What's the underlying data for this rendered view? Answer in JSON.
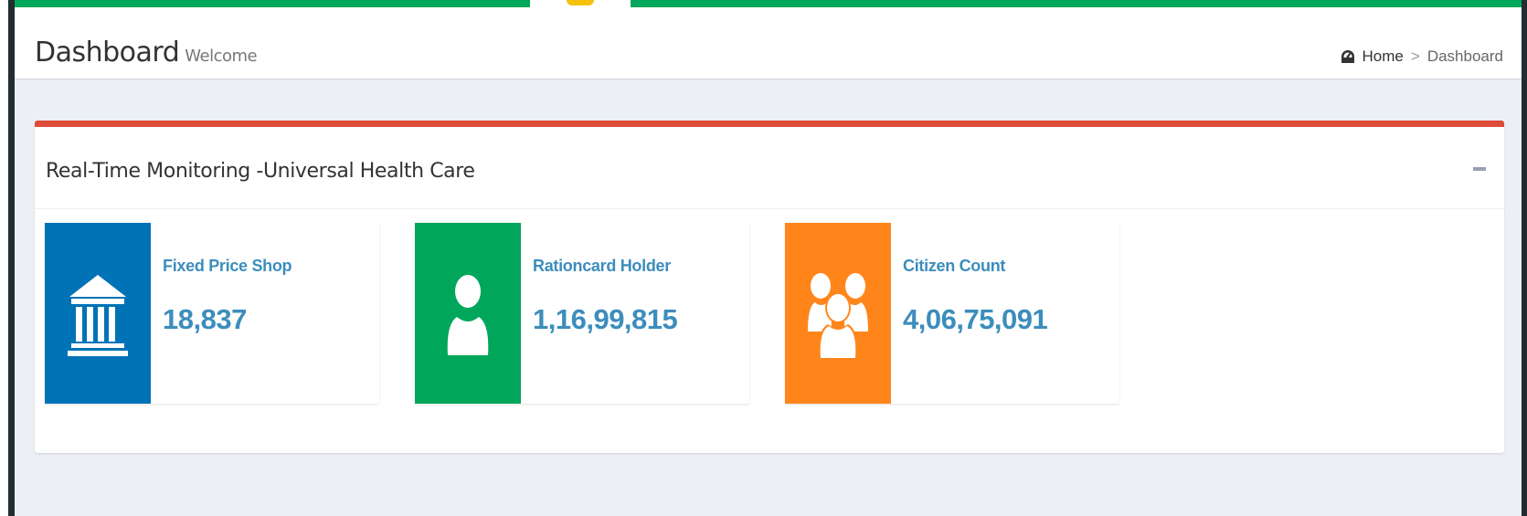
{
  "header": {
    "title": "Dashboard",
    "subtitle": "Welcome"
  },
  "breadcrumb": {
    "home_icon": "dashboard-icon",
    "home_label": "Home",
    "separator": ">",
    "current_label": "Dashboard"
  },
  "panel": {
    "title": "Real-Time Monitoring -Universal Health Care",
    "collapse_icon": "minus-icon",
    "accent_color": "#dd4b39"
  },
  "info_boxes": [
    {
      "label": "Fixed Price Shop",
      "value": "18,837",
      "icon": "bank-icon",
      "color": "#0073b7"
    },
    {
      "label": "Rationcard Holder",
      "value": "1,16,99,815",
      "icon": "user-icon",
      "color": "#00a65a"
    },
    {
      "label": "Citizen Count",
      "value": "4,06,75,091",
      "icon": "users-icon",
      "color": "#ff851b"
    }
  ],
  "theme": {
    "top_bar_color": "#00a65a",
    "text_link_color": "#3c8dbc"
  }
}
